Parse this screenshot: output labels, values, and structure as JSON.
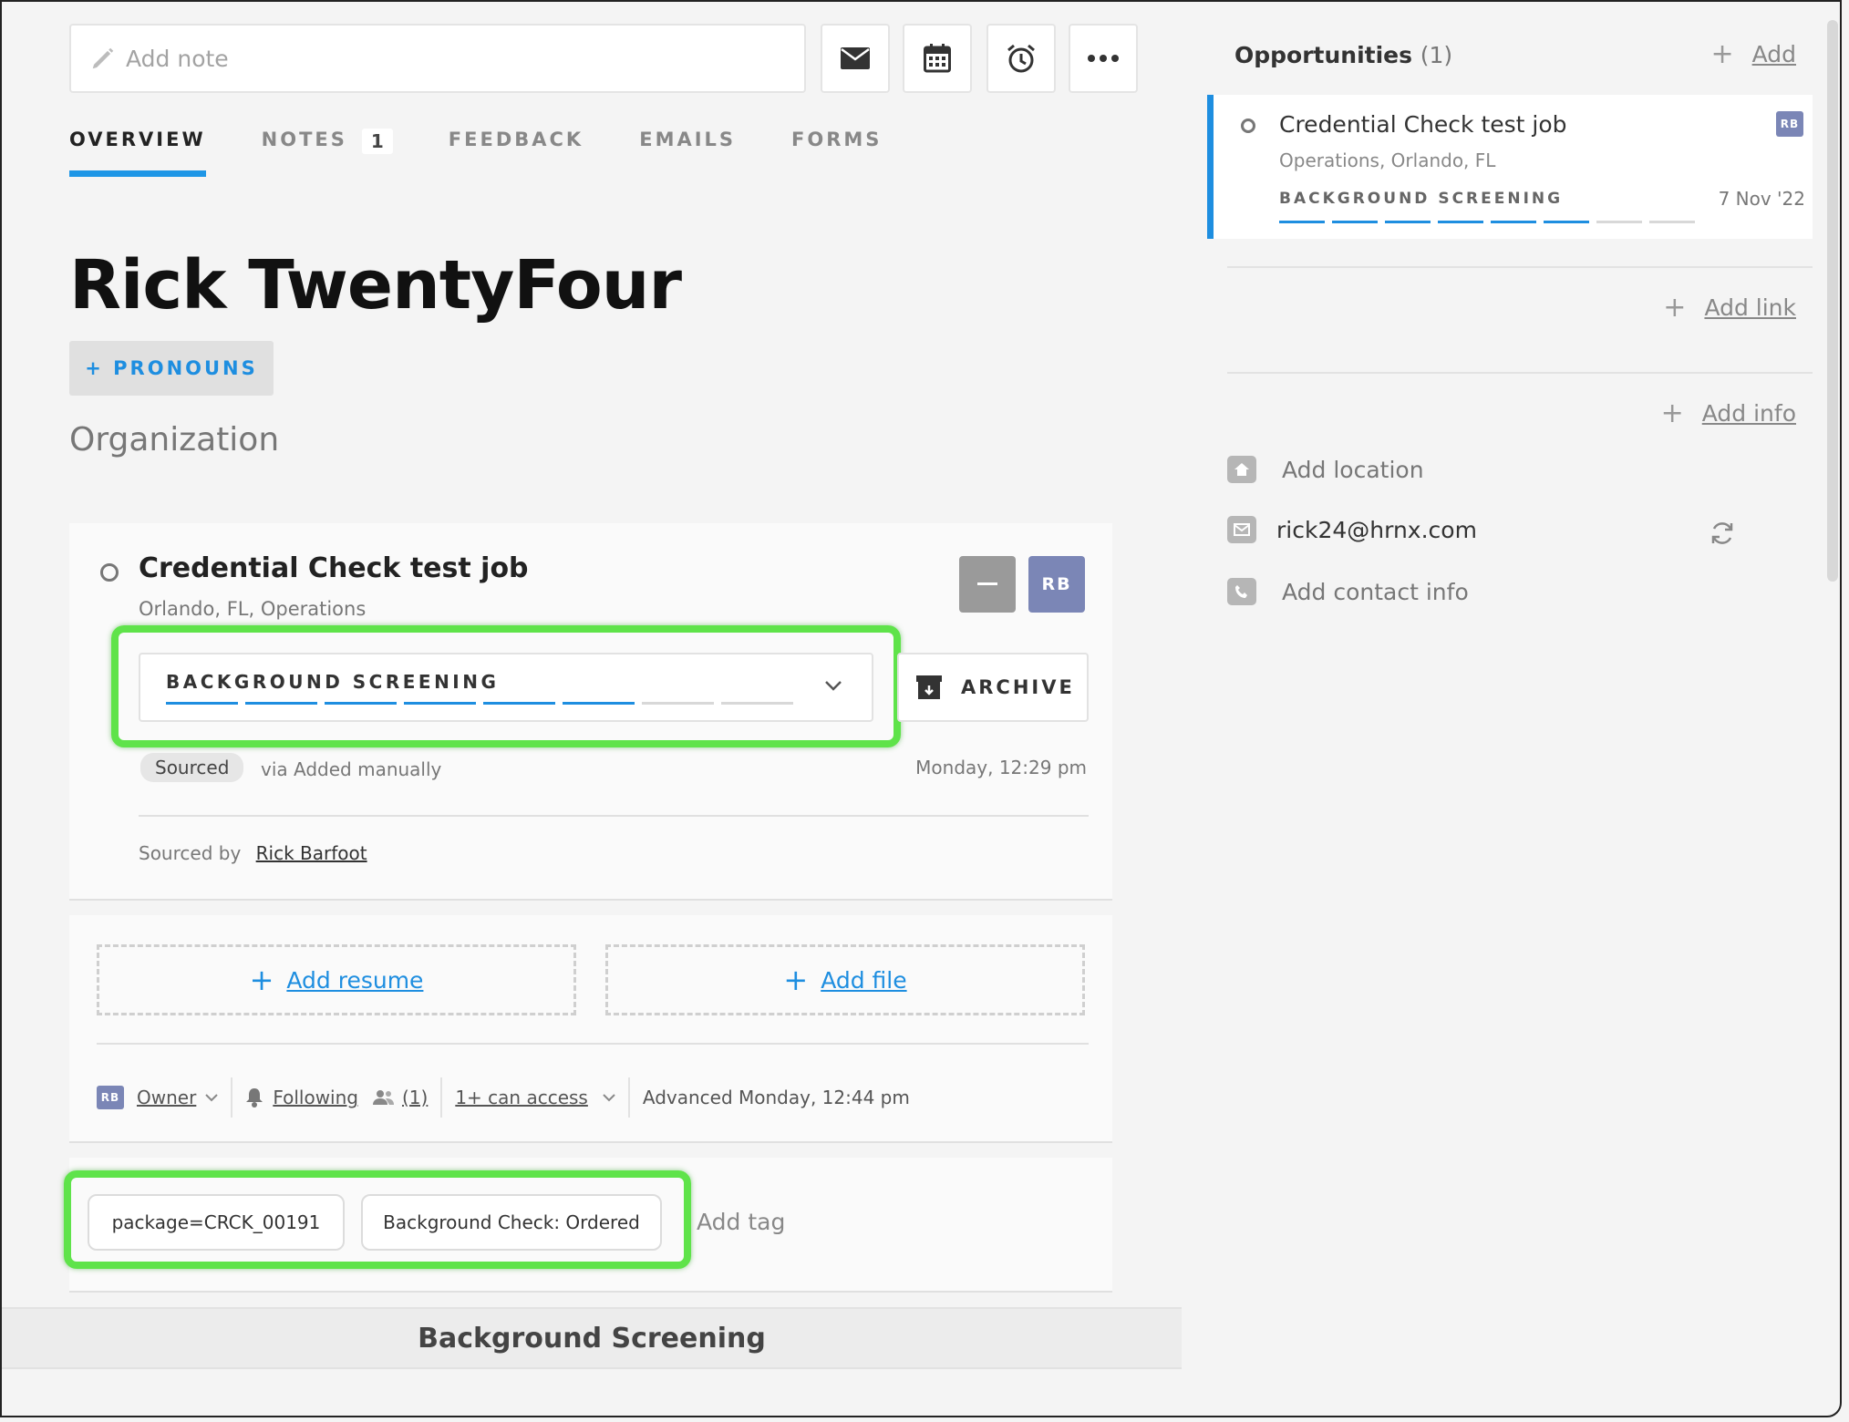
{
  "toolbar": {
    "note_placeholder": "Add note",
    "buttons": [
      "email",
      "calendar",
      "alarm",
      "more"
    ]
  },
  "tabs": [
    {
      "label": "OVERVIEW",
      "active": true
    },
    {
      "label": "NOTES",
      "count": "1"
    },
    {
      "label": "FEEDBACK"
    },
    {
      "label": "EMAILS"
    },
    {
      "label": "FORMS"
    }
  ],
  "candidate": {
    "name": "Rick TwentyFour",
    "pronouns_button": "+ PRONOUNS",
    "organization": "Organization"
  },
  "opportunity": {
    "title": "Credential Check test job",
    "subtitle": "Orlando, FL, Operations",
    "owner_initials": "RB",
    "stage": "BACKGROUND SCREENING",
    "stage_progress": {
      "completed": 6,
      "total": 8
    },
    "archive_label": "ARCHIVE",
    "source_pill": "Sourced",
    "source_via": "via Added manually",
    "timestamp": "Monday, 12:29 pm",
    "sourced_by_label": "Sourced by",
    "sourced_by_name": "Rick Barfoot"
  },
  "files": {
    "add_resume": "Add resume",
    "add_file": "Add file"
  },
  "ownership": {
    "owner_initials": "RB",
    "owner_label": "Owner",
    "following_label": "Following",
    "followers_count": "(1)",
    "access_label": "1+ can access",
    "advanced": "Advanced Monday, 12:44 pm"
  },
  "tags": {
    "items": [
      "package=CRCK_00191",
      "Background Check: Ordered"
    ],
    "add_label": "Add tag"
  },
  "section_heading": "Background Screening",
  "sidebar": {
    "opportunities_title": "Opportunities",
    "opportunities_count": "(1)",
    "add_label": "Add",
    "card": {
      "title": "Credential Check test job",
      "subtitle": "Operations, Orlando, FL",
      "stage": "BACKGROUND SCREENING",
      "date": "7 Nov '22",
      "initials": "RB"
    },
    "add_link": "Add link",
    "add_info": "Add info",
    "contacts": {
      "location": "Add location",
      "email": "rick24@hrnx.com",
      "phone": "Add contact info"
    }
  },
  "colors": {
    "accent": "#1e8ee0",
    "highlight": "#5fe34a",
    "avatar": "#7b86b6"
  }
}
